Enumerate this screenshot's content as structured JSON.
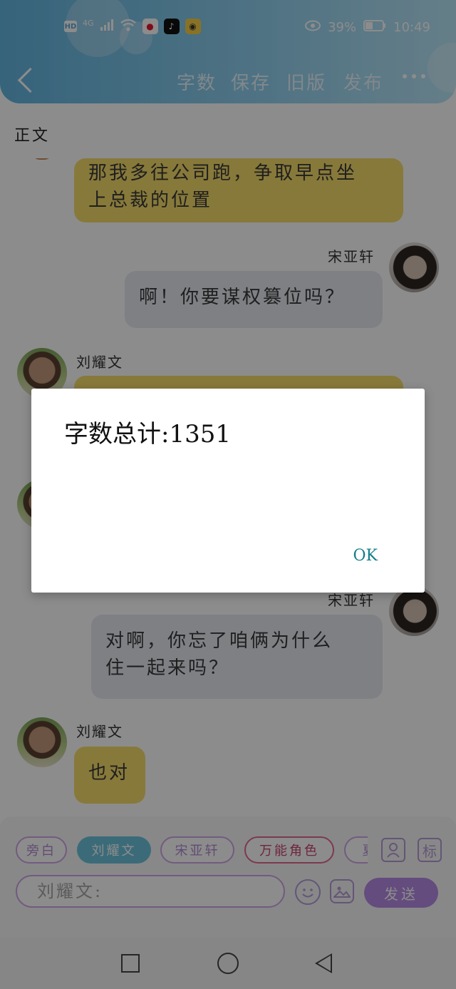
{
  "status_bar": {
    "network": "4G",
    "hd": "HD",
    "battery": "39%",
    "time": "10:49"
  },
  "toolbar": {
    "items": [
      "字数",
      "保存",
      "旧版",
      "发布"
    ]
  },
  "section": {
    "label": "正文"
  },
  "chat": {
    "messages": [
      {
        "speaker": "",
        "side": "left",
        "text_line1": "那我多往公司跑，争取早点坐",
        "text_line2": "上总裁的位置",
        "color": "yellow"
      },
      {
        "speaker": "宋亚轩",
        "side": "right",
        "text": "啊！你要谋权篡位吗？",
        "color": "gray"
      },
      {
        "speaker": "刘耀文",
        "side": "left",
        "text": "",
        "color": "yellow"
      },
      {
        "speaker": "宋亚轩",
        "side": "right",
        "text_line1": "对啊，你忘了咱俩为什么",
        "text_line2": "住一起来吗？",
        "color": "gray"
      },
      {
        "speaker": "刘耀文",
        "side": "left",
        "text": "也对",
        "color": "yellow"
      }
    ]
  },
  "roles": {
    "items": [
      "旁白",
      "刘耀文",
      "宋亚轩",
      "万能角色",
      "夏"
    ],
    "active": "刘耀文"
  },
  "side_buttons": {
    "label_button": "标"
  },
  "composer": {
    "placeholder": "刘耀文:",
    "send_label": "发送"
  },
  "dialog": {
    "message": "字数总计:1351",
    "ok_label": "OK"
  },
  "colors": {
    "header_start": "#63b6e0",
    "bubble_left": "#f6dc6a",
    "bubble_right": "#e5eaf1",
    "accent_purple": "#b68be6",
    "ok_teal": "#137e88"
  }
}
